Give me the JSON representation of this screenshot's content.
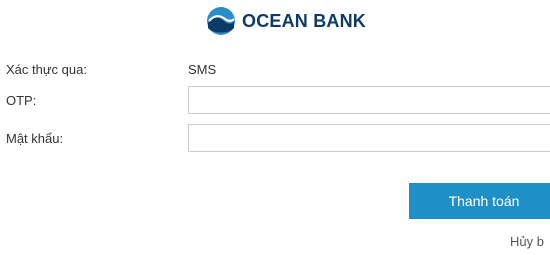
{
  "brand": {
    "name": "OCEAN BANK",
    "logo_icon": "ocean-wave-logo",
    "text_color": "#0b3b66",
    "logo_color": "#2a8ec9"
  },
  "form": {
    "auth_method_label": "Xác thực qua:",
    "auth_method_value": "SMS",
    "otp_label": "OTP:",
    "otp_value": "",
    "password_label": "Mật khẩu:",
    "password_value": ""
  },
  "actions": {
    "pay_label": "Thanh toán",
    "pay_color": "#1f8fc7",
    "cancel_label": "Hủy b"
  }
}
